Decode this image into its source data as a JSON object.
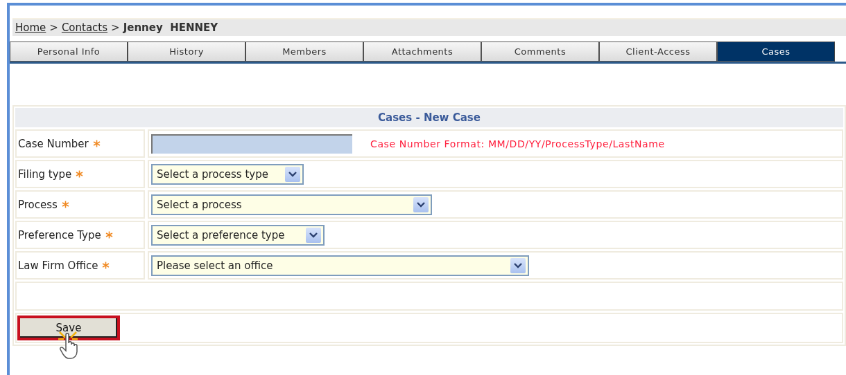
{
  "breadcrumb": [
    {
      "kind": "link",
      "label": "Home"
    },
    {
      "kind": "sep",
      "label": ">"
    },
    {
      "kind": "link",
      "label": "Contacts"
    },
    {
      "kind": "sep",
      "label": ">"
    },
    {
      "kind": "current",
      "label": "Jenney  HENNEY"
    }
  ],
  "tabs": [
    {
      "label": "Personal Info",
      "selected": false
    },
    {
      "label": "History",
      "selected": false
    },
    {
      "label": "Members",
      "selected": false
    },
    {
      "label": "Attachments",
      "selected": false
    },
    {
      "label": "Comments",
      "selected": false
    },
    {
      "label": "Client-Access",
      "selected": false
    },
    {
      "label": "Cases",
      "selected": true
    }
  ],
  "form": {
    "title": "Cases - New Case",
    "fields": [
      {
        "label": "Case Number",
        "required": true,
        "kind": "text",
        "focused": true,
        "hint": "Case Number Format: MM/DD/YY/ProcessType/LastName"
      },
      {
        "label": "Filing type",
        "required": true,
        "kind": "select",
        "value": "Select a process type"
      },
      {
        "label": "Process",
        "required": true,
        "kind": "select",
        "value": "Select a process"
      },
      {
        "label": "Preference Type",
        "required": true,
        "kind": "select",
        "value": "Select a preference type"
      },
      {
        "label": "Law Firm Office",
        "required": true,
        "kind": "select",
        "value": "Please select an office"
      }
    ],
    "save_button": {
      "label": "Save",
      "highlighted": true
    }
  }
}
